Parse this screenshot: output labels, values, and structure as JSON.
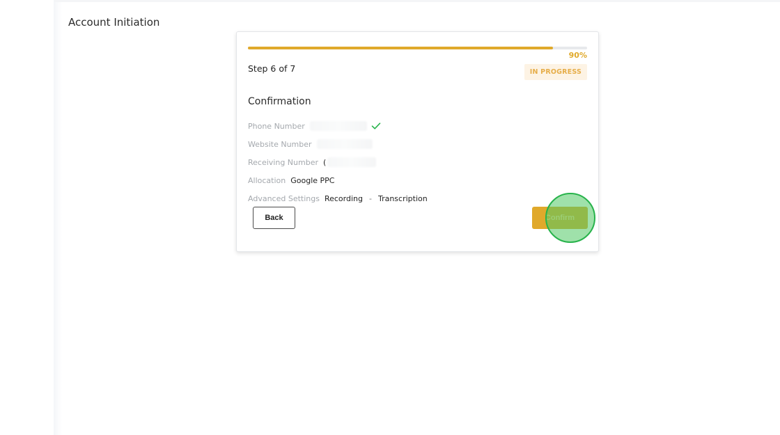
{
  "page": {
    "title": "Account Initiation"
  },
  "wizard": {
    "progress_percent": 90,
    "progress_label": "90%",
    "step_label": "Step 6 of 7",
    "status_badge": "IN PROGRESS",
    "section_title": "Confirmation",
    "rows": {
      "phone_number": {
        "label": "Phone Number",
        "value": ""
      },
      "website_number": {
        "label": "Website Number",
        "value": ""
      },
      "receiving_number": {
        "label": "Receiving Number",
        "value": "("
      },
      "allocation": {
        "label": "Allocation",
        "value": "Google PPC"
      },
      "advanced_settings": {
        "label": "Advanced Settings",
        "value_1": "Recording",
        "separator": "-",
        "value_2": "Transcription"
      }
    },
    "buttons": {
      "back": "Back",
      "confirm": "Confirm"
    }
  },
  "colors": {
    "accent": "#e0a92b",
    "badge_bg": "#fdf3e4",
    "check": "#27b34b",
    "click_indicator": "#27b34b"
  },
  "icons": {
    "phone_verified": "check-icon"
  }
}
